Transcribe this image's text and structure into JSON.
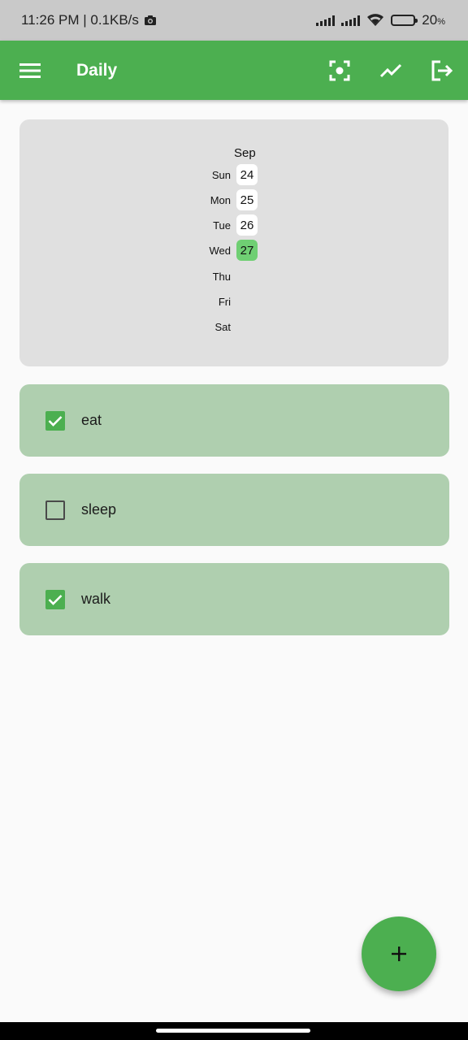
{
  "status_bar": {
    "time_net": "11:26 PM | 0.1KB/s",
    "battery_percent": "20",
    "battery_symbol": "%",
    "battery_level": 0.2
  },
  "app_bar": {
    "title": "Daily",
    "background": "#4caf50",
    "icons": [
      "menu-icon",
      "focus-icon",
      "trending-up-icon",
      "logout-icon"
    ]
  },
  "calendar": {
    "month": "Sep",
    "days": [
      {
        "day": "Sun",
        "date": "24",
        "selected": false
      },
      {
        "day": "Mon",
        "date": "25",
        "selected": false
      },
      {
        "day": "Tue",
        "date": "26",
        "selected": false
      },
      {
        "day": "Wed",
        "date": "27",
        "selected": true
      },
      {
        "day": "Thu",
        "date": ""
      },
      {
        "day": "Fri",
        "date": ""
      },
      {
        "day": "Sat",
        "date": ""
      }
    ]
  },
  "habits": [
    {
      "label": "eat",
      "checked": true
    },
    {
      "label": "sleep",
      "checked": false
    },
    {
      "label": "walk",
      "checked": true
    }
  ],
  "fab": {
    "icon": "plus-icon"
  },
  "colors": {
    "primary": "#4caf50",
    "card": "#afcfaf",
    "calendar_bg": "#e0e0e0",
    "selected_date": "#6fcf73"
  }
}
